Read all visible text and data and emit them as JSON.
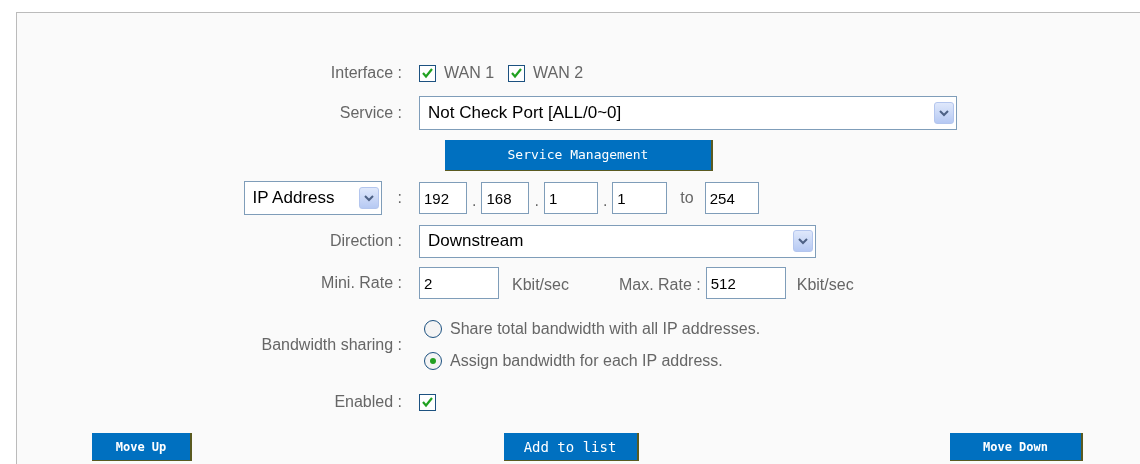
{
  "interface": {
    "label": "Interface :",
    "options": [
      {
        "label": "WAN 1",
        "checked": true
      },
      {
        "label": "WAN 2",
        "checked": true
      }
    ]
  },
  "service": {
    "label": "Service :",
    "value": "Not Check Port [ALL/0~0]",
    "button": "Service Management"
  },
  "address": {
    "type_select": "IP Address",
    "colon": ":",
    "octets": [
      "192",
      "168",
      "1",
      "1"
    ],
    "separator": ".",
    "to_label": "to",
    "end": "254"
  },
  "direction": {
    "label": "Direction :",
    "value": "Downstream"
  },
  "rates": {
    "min_label": "Mini. Rate :",
    "min_value": "2",
    "min_unit": "Kbit/sec",
    "max_label": "Max. Rate :",
    "max_value": "512",
    "max_unit": "Kbit/sec"
  },
  "bandwidth_sharing": {
    "label": "Bandwidth sharing :",
    "options": [
      {
        "label": "Share total bandwidth with all IP addresses.",
        "selected": false
      },
      {
        "label": "Assign bandwidth for each IP address.",
        "selected": true
      }
    ]
  },
  "enabled": {
    "label": "Enabled  :",
    "checked": true
  },
  "buttons": [
    {
      "label": "Move Up"
    },
    {
      "label": "Add to list"
    },
    {
      "label": "Move Down"
    }
  ]
}
